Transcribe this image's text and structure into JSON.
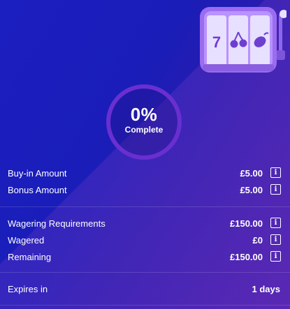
{
  "progress": {
    "percent_text": "0%",
    "label": "Complete",
    "fraction": 0
  },
  "slot_symbols": [
    "7",
    "cherries-icon",
    "lemon-icon"
  ],
  "colors": {
    "background": "#1a1fb2",
    "ring_track": "#6a2fd0",
    "slot_body": "#9b6cf0"
  },
  "bonus": {
    "buy_in_label": "Buy-in Amount",
    "buy_in_value": "£5.00",
    "bonus_label": "Bonus Amount",
    "bonus_value": "£5.00"
  },
  "wagering": {
    "requirements_label": "Wagering Requirements",
    "requirements_value": "£150.00",
    "wagered_label": "Wagered",
    "wagered_value": "£0",
    "remaining_label": "Remaining",
    "remaining_value": "£150.00"
  },
  "expiry": {
    "label": "Expires in",
    "value": "1 days"
  },
  "info_icon_glyph": "i"
}
